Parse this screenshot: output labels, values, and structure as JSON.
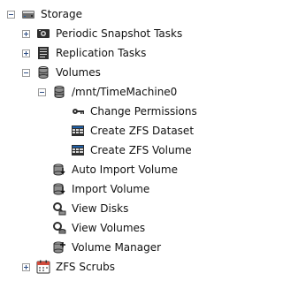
{
  "tree": {
    "root": {
      "label": "Storage",
      "icon": "storage-drive-icon",
      "state": "expanded"
    },
    "items": [
      {
        "key": "periodic-snapshot-tasks",
        "label": "Periodic Snapshot Tasks",
        "icon": "snapshot-task-icon",
        "toggle": "collapsed"
      },
      {
        "key": "replication-tasks",
        "label": "Replication Tasks",
        "icon": "replication-task-icon",
        "toggle": "collapsed"
      },
      {
        "key": "volumes",
        "label": "Volumes",
        "icon": "volumes-icon",
        "toggle": "expanded"
      },
      {
        "key": "mnt-timemachine0",
        "label": "/mnt/TimeMachine0",
        "icon": "volume-icon",
        "toggle": "expanded"
      },
      {
        "key": "change-permissions",
        "label": "Change Permissions",
        "icon": "key-icon"
      },
      {
        "key": "create-zfs-dataset",
        "label": "Create ZFS Dataset",
        "icon": "dataset-table-icon"
      },
      {
        "key": "create-zfs-volume",
        "label": "Create ZFS Volume",
        "icon": "zfs-volume-table-icon"
      },
      {
        "key": "auto-import-volume",
        "label": "Auto Import Volume",
        "icon": "auto-import-icon"
      },
      {
        "key": "import-volume",
        "label": "Import Volume",
        "icon": "import-volume-icon"
      },
      {
        "key": "view-disks",
        "label": "View Disks",
        "icon": "view-disks-icon"
      },
      {
        "key": "view-volumes",
        "label": "View Volumes",
        "icon": "view-volumes-icon"
      },
      {
        "key": "volume-manager",
        "label": "Volume Manager",
        "icon": "volume-manager-icon"
      },
      {
        "key": "zfs-scrubs",
        "label": "ZFS Scrubs",
        "icon": "calendar-icon",
        "toggle": "collapsed"
      }
    ]
  },
  "colors": {
    "text": "#111111",
    "toggle_border": "#9a9a9a",
    "toggle_mark": "#2d4d85",
    "icon_dark": "#2f2f2f",
    "icon_mid": "#7a7a7a",
    "icon_light": "#d8d8d8",
    "accent_blue": "#1e5fa8",
    "accent_red": "#d14b3c"
  }
}
